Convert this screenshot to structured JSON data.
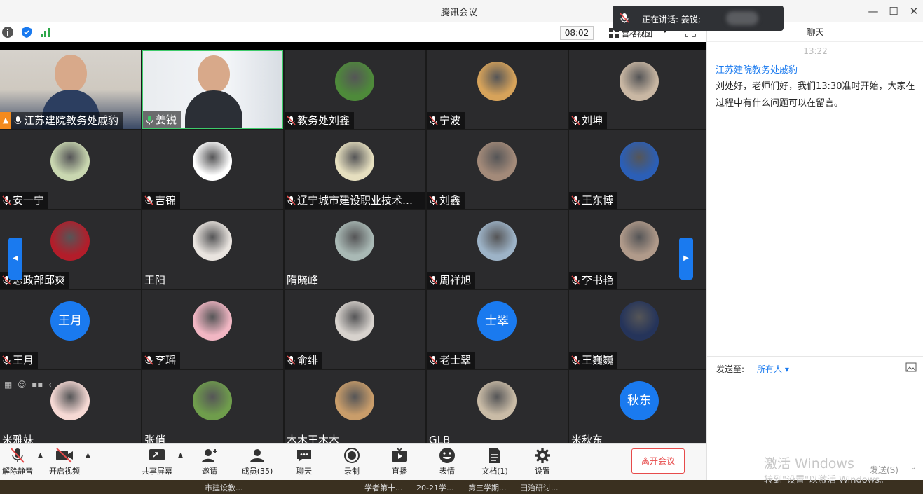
{
  "window": {
    "title": "腾讯会议"
  },
  "toast": {
    "label": "正在讲话: 姜锐;"
  },
  "toolbar": {
    "timer": "08:02",
    "view_label": "宫格视图"
  },
  "participants": [
    {
      "name": "江苏建院教务处戚豹",
      "kind": "video1",
      "mic": "on",
      "host": true
    },
    {
      "name": "姜锐",
      "kind": "video2",
      "mic": "on-green"
    },
    {
      "name": "教务处刘鑫",
      "kind": "img",
      "mic": "muted",
      "color": "#4e8a3a"
    },
    {
      "name": "宁波",
      "kind": "img",
      "mic": "muted",
      "color": "#d7a35a"
    },
    {
      "name": "刘坤",
      "kind": "img",
      "mic": "muted",
      "color": "#c9b7a3"
    },
    {
      "name": "安一宁",
      "kind": "img",
      "mic": "muted",
      "color": "#c9d7b0"
    },
    {
      "name": "吉锦",
      "kind": "img",
      "mic": "muted",
      "color": "#ffffff"
    },
    {
      "name": "辽宁城市建设职业技术学院",
      "kind": "img",
      "mic": "muted",
      "color": "#e6dfbf"
    },
    {
      "name": "刘鑫",
      "kind": "img",
      "mic": "muted",
      "color": "#a38a79"
    },
    {
      "name": "王东博",
      "kind": "img",
      "mic": "muted",
      "color": "#2b5fb7"
    },
    {
      "name": "思政部邱爽",
      "kind": "img",
      "mic": "muted",
      "color": "#b31d2a"
    },
    {
      "name": "王阳",
      "kind": "img",
      "mic": "none",
      "color": "#e9e4df"
    },
    {
      "name": "隋晓峰",
      "kind": "img",
      "mic": "none",
      "color": "#a9b9b5"
    },
    {
      "name": "周祥旭",
      "kind": "img",
      "mic": "muted",
      "color": "#9db3c7"
    },
    {
      "name": "李书艳",
      "kind": "img",
      "mic": "muted",
      "color": "#b09a8a"
    },
    {
      "name": "王月",
      "kind": "text",
      "avatar_text": "王月",
      "mic": "muted"
    },
    {
      "name": "李瑶",
      "kind": "img",
      "mic": "muted",
      "color": "#f1b6c3"
    },
    {
      "name": "俞绯",
      "kind": "img",
      "mic": "muted",
      "color": "#d7d2cd"
    },
    {
      "name": "老士翠",
      "kind": "text",
      "avatar_text": "士翠",
      "mic": "muted"
    },
    {
      "name": "王巍巍",
      "kind": "img",
      "mic": "muted",
      "color": "#25345a"
    },
    {
      "name": "米雅妹",
      "kind": "img",
      "mic": "none",
      "color": "#f6d9d4"
    },
    {
      "name": "张俏",
      "kind": "img",
      "mic": "none",
      "color": "#6f9d4c"
    },
    {
      "name": "木木王木木",
      "kind": "img",
      "mic": "none",
      "color": "#c99d6a"
    },
    {
      "name": "GLB",
      "kind": "img",
      "mic": "none",
      "color": "#c9bba6"
    },
    {
      "name": "米秋东",
      "kind": "text",
      "avatar_text": "秋东",
      "mic": "none"
    }
  ],
  "bottom": {
    "unmute": "解除静音",
    "video": "开启视频",
    "share": "共享屏幕",
    "invite": "邀请",
    "members": "成员(35)",
    "chat": "聊天",
    "record": "录制",
    "live": "直播",
    "emoji": "表情",
    "docs": "文档(1)",
    "settings": "设置",
    "leave": "离开会议"
  },
  "chat": {
    "header": "聊天",
    "time": "13:22",
    "sender": "江苏建院教务处戚豹",
    "message": "刘处好，老师们好，我们13:30准时开始，大家在过程中有什么问题可以在留言。",
    "send_to_label": "发送至:",
    "send_to_value": "所有人",
    "watermark_title": "激活 Windows",
    "watermark_sub": "转到\"设置\"以激活 Windows。",
    "send_button": "发送(S)"
  },
  "taskbar": [
    "市建设教...",
    "学者第十...",
    "20-21学...",
    "第三学期...",
    "田治研讨..."
  ],
  "colors": {
    "accent": "#1a7aef",
    "danger": "#e74b4b",
    "speaking_border": "#3ecb6b"
  }
}
